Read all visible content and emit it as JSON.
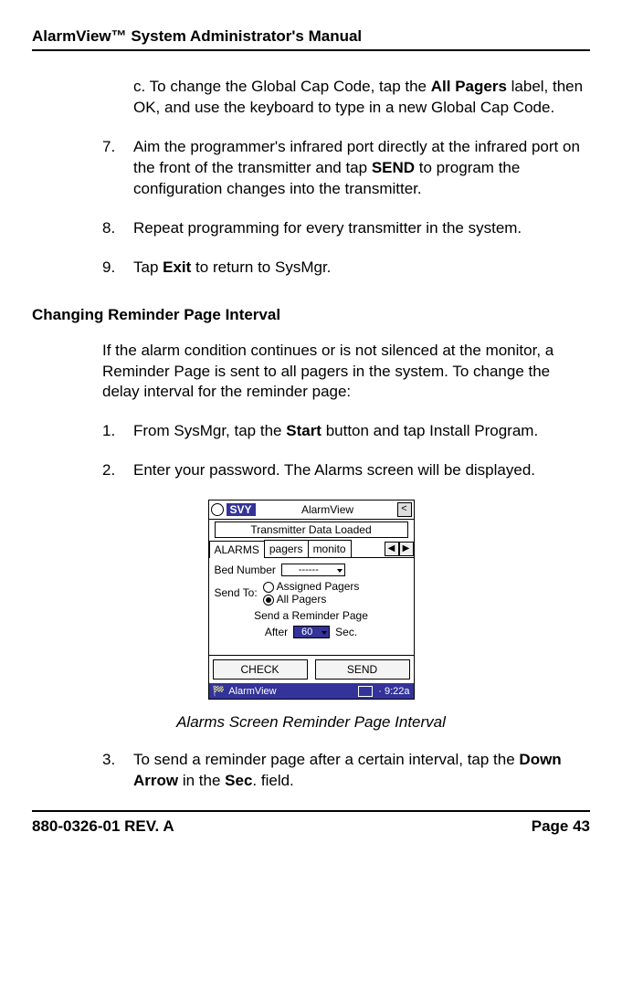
{
  "header": "AlarmView™ System Administrator's Manual",
  "p_c_1": "c. To change the Global Cap Code, tap the ",
  "p_c_bold1": "All Pagers",
  "p_c_2": " label, then OK, and use the keyboard to type in a new Global Cap Code.",
  "n7_num": "7.",
  "n7_1": "Aim the programmer's infrared port directly at the infrared port on the front of the transmitter and tap ",
  "n7_bold": "SEND",
  "n7_2": " to program the configuration changes into the transmitter.",
  "n8_num": "8.",
  "n8": "Repeat programming for every transmitter in the system.",
  "n9_num": "9.",
  "n9_1": "Tap ",
  "n9_bold": "Exit",
  "n9_2": " to return to SysMgr.",
  "section_head": "Changing Reminder Page Interval",
  "p_intro": "If the alarm condition continues or is not silenced at the monitor, a Reminder Page is sent to all pagers in the system. To change the delay interval for the reminder page:",
  "n1_num": "1.",
  "n1_1": "From SysMgr, tap the ",
  "n1_bold": "Start",
  "n1_2": " button and tap Install Program.",
  "n2_num": "2.",
  "n2": "Enter your password. The Alarms screen will be displayed.",
  "caption": "Alarms Screen Reminder Page Interval",
  "n3_num": "3.",
  "n3_1": "To send a reminder page after a certain interval, tap the ",
  "n3_bold1": "Down Arrow",
  "n3_2": " in the ",
  "n3_bold2": "Sec",
  "n3_3": ". field.",
  "footer_left": "880-0326-01 REV. A",
  "footer_right": "Page 43",
  "device": {
    "svy": "SVY",
    "title": "AlarmView",
    "close": "<",
    "status": "Transmitter Data Loaded",
    "tab1": "ALARMS",
    "tab2": "pagers",
    "tab3": "monito",
    "left_arrow": "◀",
    "right_arrow": "▶",
    "bed_label": "Bed Number",
    "bed_value": "------",
    "sendto": "Send To:",
    "opt1": "Assigned Pagers",
    "opt2": "All Pagers",
    "reminder": "Send a Reminder Page",
    "after": "After",
    "secval": "60",
    "sec": "Sec.",
    "check": "CHECK",
    "send": "SEND",
    "taskapp": "AlarmView",
    "time": "9:22a"
  }
}
